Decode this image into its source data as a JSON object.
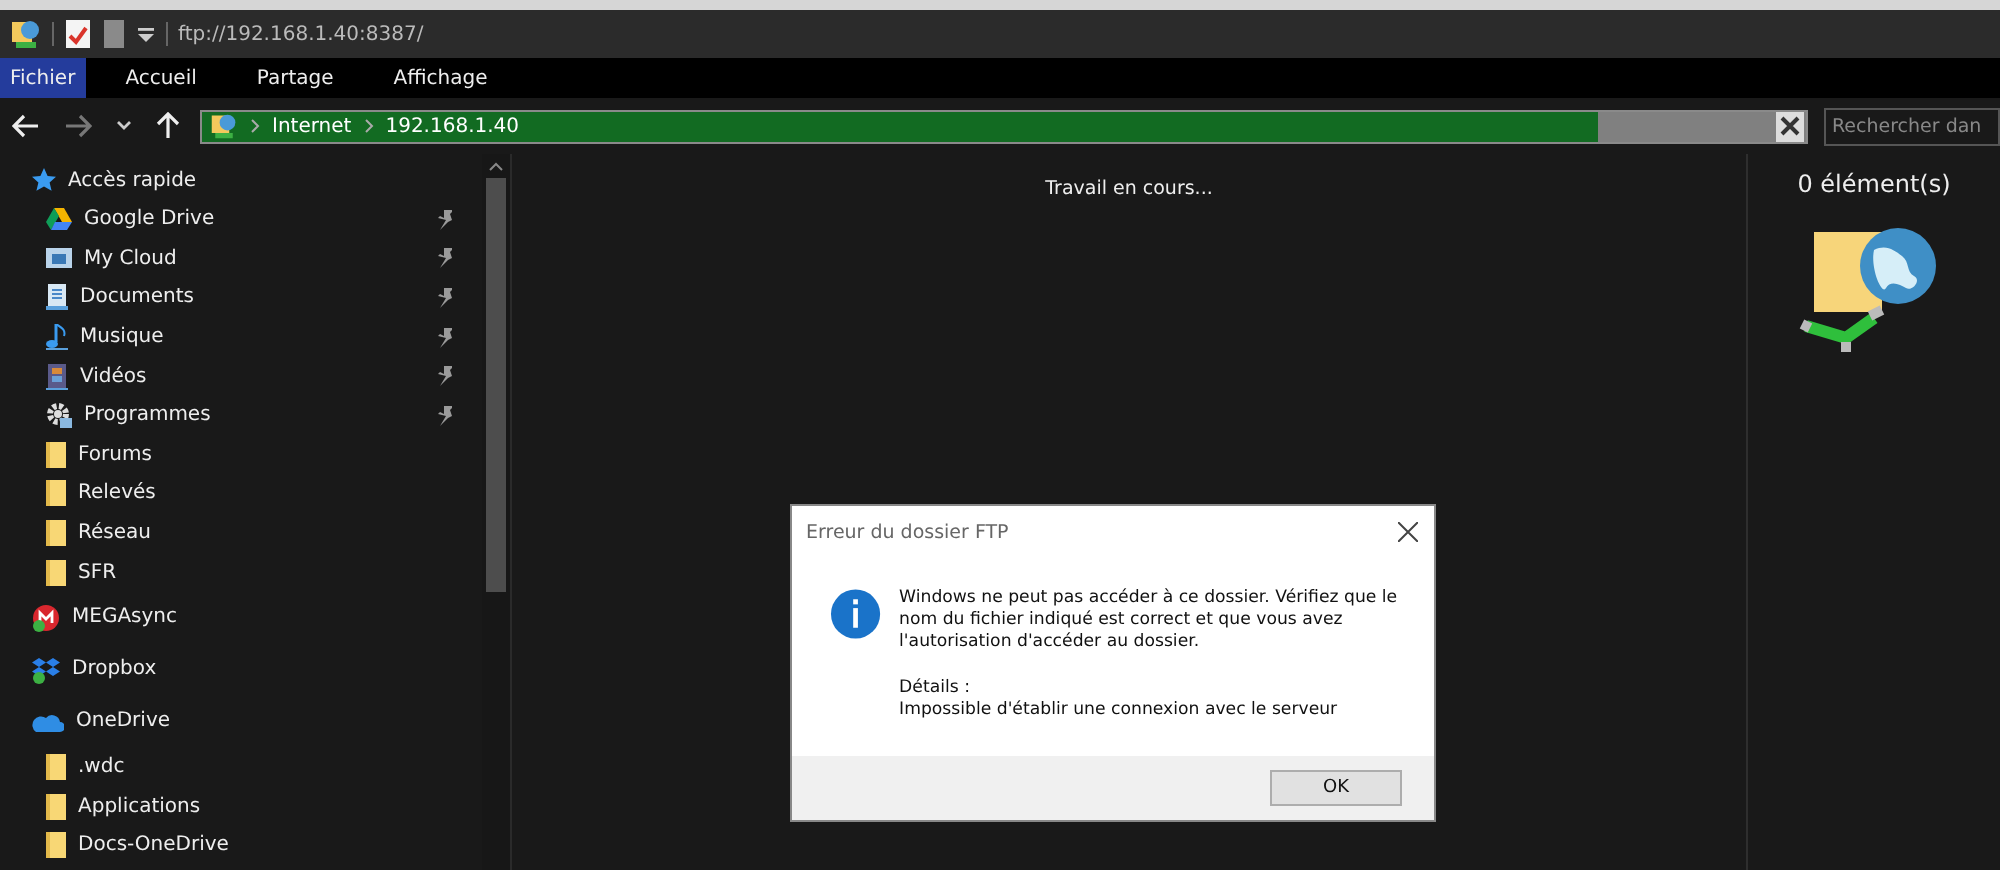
{
  "window": {
    "title": "ftp://192.168.1.40:8387/"
  },
  "ribbon_tabs": [
    {
      "label": "Fichier",
      "selected": true
    },
    {
      "label": "Accueil",
      "selected": false
    },
    {
      "label": "Partage",
      "selected": false
    },
    {
      "label": "Affichage",
      "selected": false
    }
  ],
  "address_bar": {
    "crumbs": [
      "Internet",
      "192.168.1.40"
    ],
    "level": 0.87
  },
  "search": {
    "placeholder": "Rechercher dan"
  },
  "sidebar": {
    "sections": [
      {
        "label": "Accès rapide",
        "kind": "star",
        "children": [
          {
            "label": "Google Drive",
            "kind": "drive",
            "pinned": true
          },
          {
            "label": "My Cloud",
            "kind": "cloud",
            "pinned": true
          },
          {
            "label": "Documents",
            "kind": "document",
            "pinned": true
          },
          {
            "label": "Musique",
            "kind": "music",
            "pinned": true
          },
          {
            "label": "Vidéos",
            "kind": "video",
            "pinned": true
          },
          {
            "label": "Programmes",
            "kind": "gear",
            "pinned": true
          },
          {
            "label": "Forums",
            "kind": "folder",
            "pinned": false
          },
          {
            "label": "Relevés",
            "kind": "folder",
            "pinned": false
          },
          {
            "label": "Réseau",
            "kind": "folder",
            "pinned": false
          },
          {
            "label": "SFR",
            "kind": "folder",
            "pinned": false
          }
        ]
      },
      {
        "label": "MEGAsync",
        "kind": "mega"
      },
      {
        "label": "Dropbox",
        "kind": "dropbox"
      },
      {
        "label": "OneDrive",
        "kind": "onedrive",
        "children": [
          {
            "label": ".wdc",
            "kind": "folder",
            "pinned": false
          },
          {
            "label": "Applications",
            "kind": "folder",
            "pinned": false
          },
          {
            "label": "Docs-OneDrive",
            "kind": "folder",
            "pinned": false
          }
        ]
      }
    ]
  },
  "content": {
    "status": "Travail en cours..."
  },
  "details": {
    "count": "0 élément(s)"
  },
  "dialog": {
    "title": "Erreur du dossier FTP",
    "message": "Windows ne peut pas accéder à ce dossier. Vérifiez que le nom du fichier indiqué est correct et que vous avez l'autorisation d'accéder au dossier.",
    "details_label": "Détails :",
    "details_text": "Impossible d'établir une connexion avec le serveur",
    "buttons": [
      "OK"
    ]
  }
}
